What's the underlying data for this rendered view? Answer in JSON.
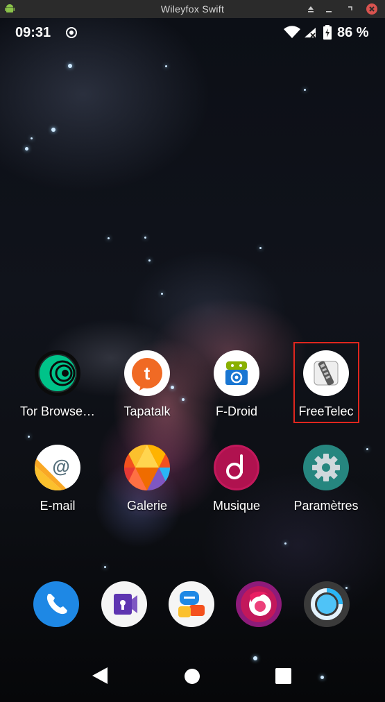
{
  "window": {
    "title": "Wileyfox Swift",
    "controls": [
      "minimize-up",
      "minimize",
      "restore",
      "close"
    ]
  },
  "statusbar": {
    "time": "09:31",
    "battery": "86 %"
  },
  "apps": [
    {
      "label": "Tor Browse…",
      "icon": "tor-browser-icon"
    },
    {
      "label": "Tapatalk",
      "icon": "tapatalk-icon"
    },
    {
      "label": "F-Droid",
      "icon": "fdroid-icon"
    },
    {
      "label": "FreeTelec",
      "icon": "remote-control-icon",
      "selected": true
    },
    {
      "label": "E-mail",
      "icon": "email-icon"
    },
    {
      "label": "Galerie",
      "icon": "gallery-icon"
    },
    {
      "label": "Musique",
      "icon": "music-icon"
    },
    {
      "label": "Paramètres",
      "icon": "settings-gear-icon"
    }
  ],
  "dock": [
    "phone-icon",
    "video-call-icon",
    "messages-icon",
    "firefox-icon",
    "assistant-ring-icon"
  ],
  "navbar": [
    "back-icon",
    "home-icon",
    "recents-icon"
  ],
  "colors": {
    "selection": "#e0261e",
    "titlebar": "#2b2b2b"
  }
}
